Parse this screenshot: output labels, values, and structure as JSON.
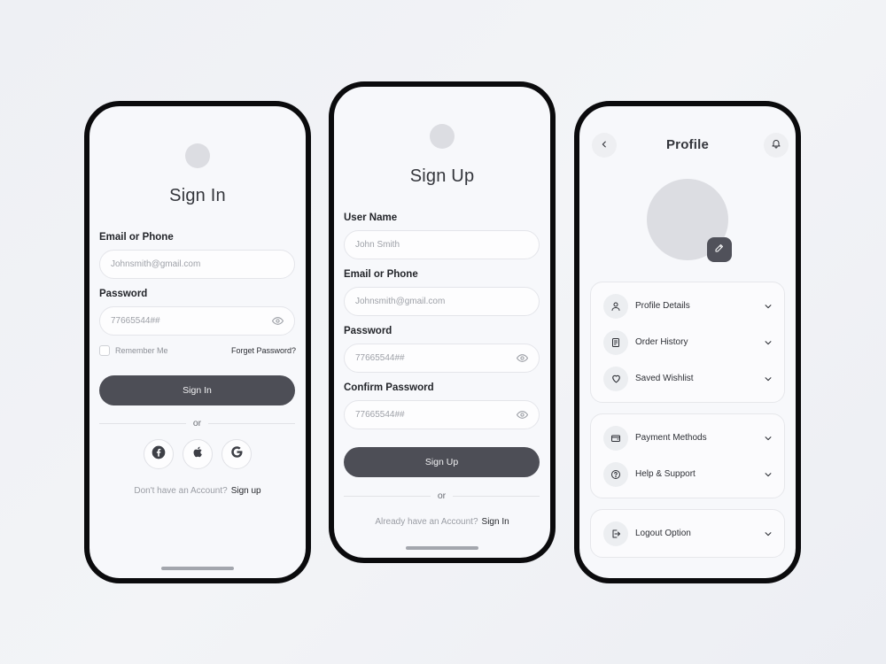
{
  "signin": {
    "title": "Sign In",
    "email_label": "Email or Phone",
    "email_placeholder": "Johnsmith@gmail.com",
    "password_label": "Password",
    "password_placeholder": "77665544##",
    "remember_label": "Remember Me",
    "forget_label": "Forget Password?",
    "button_label": "Sign In",
    "or_text": "or",
    "social": [
      "facebook-icon",
      "apple-icon",
      "google-icon"
    ],
    "footer_text": "Don't have an Account?",
    "footer_link": "Sign up"
  },
  "signup": {
    "title": "Sign Up",
    "username_label": "User Name",
    "username_placeholder": "John Smith",
    "email_label": "Email or Phone",
    "email_placeholder": "Johnsmith@gmail.com",
    "password_label": "Password",
    "password_placeholder": "77665544##",
    "confirm_label": "Confirm Password",
    "confirm_placeholder": "77665544##",
    "button_label": "Sign Up",
    "or_text": "or",
    "footer_text": "Already have an Account?",
    "footer_link": "Sign In"
  },
  "profile": {
    "title": "Profile",
    "group1": [
      {
        "label": "Profile Details",
        "icon": "user-icon"
      },
      {
        "label": "Order History",
        "icon": "receipt-icon"
      },
      {
        "label": "Saved Wishlist",
        "icon": "heart-icon"
      }
    ],
    "group2": [
      {
        "label": "Payment Methods",
        "icon": "wallet-icon"
      },
      {
        "label": "Help & Support",
        "icon": "help-icon"
      }
    ],
    "group3": [
      {
        "label": "Logout Option",
        "icon": "logout-icon"
      }
    ]
  },
  "colors": {
    "primary_button": "#4d4e56",
    "placeholder_avatar": "#dcdde2",
    "phone_frame": "#0b0b0d"
  }
}
